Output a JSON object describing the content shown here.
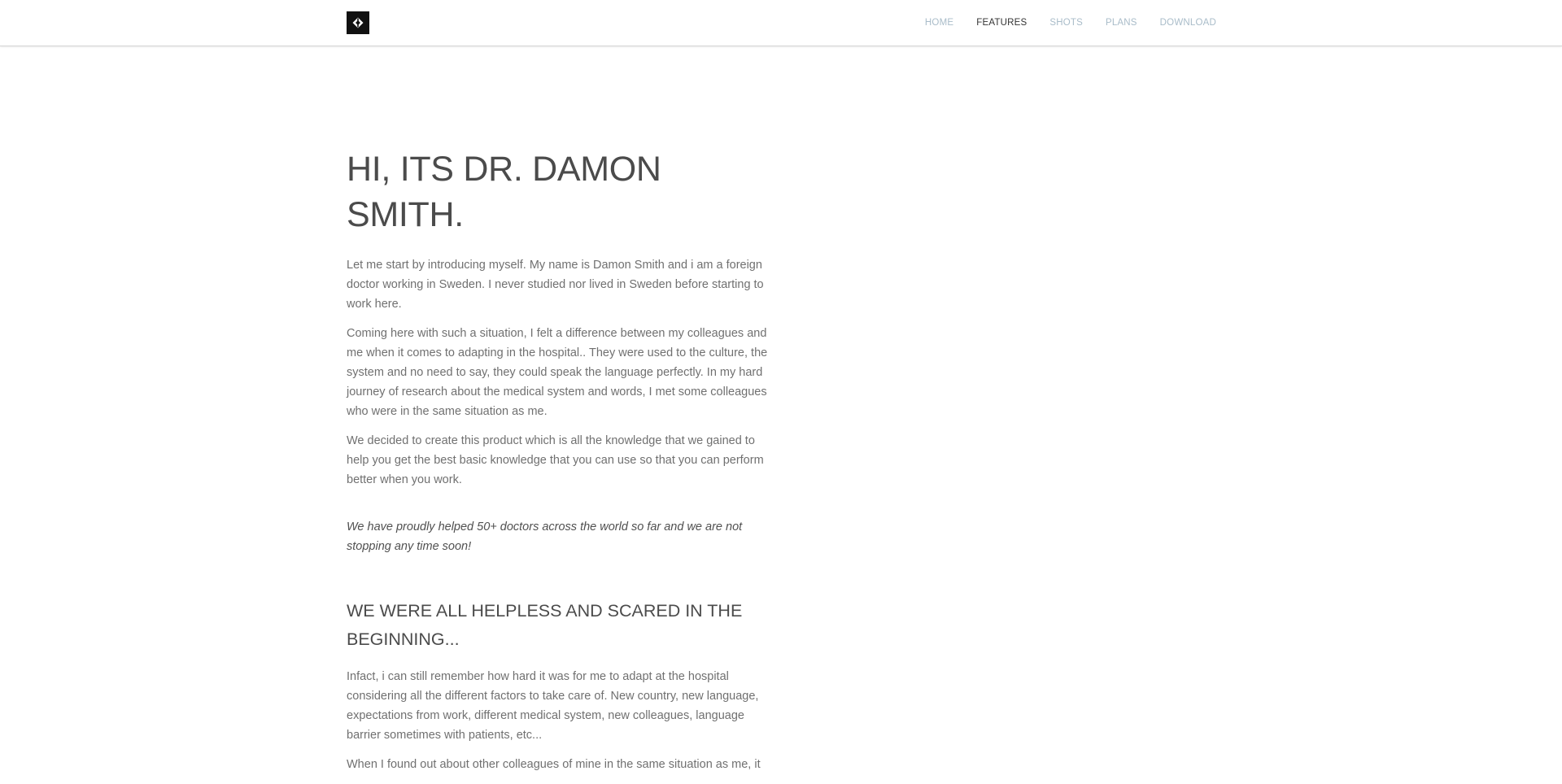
{
  "nav": {
    "logo_icon": "diamond-logo-icon",
    "items": [
      {
        "label": "HOME",
        "active": false
      },
      {
        "label": "FEATURES",
        "active": true
      },
      {
        "label": "SHOTS",
        "active": false
      },
      {
        "label": "PLANS",
        "active": false
      },
      {
        "label": "DOWNLOAD",
        "active": false
      }
    ]
  },
  "main": {
    "title": "HI, ITS DR. DAMON SMITH.",
    "paragraphs": [
      "Let me start by introducing myself. My name is Damon Smith and i am a foreign doctor working in Sweden. I never studied nor lived in Sweden before starting to work here.",
      "Coming here with such a situation, I felt a difference between my colleagues and me when it comes to adapting in the hospital.. They were used to the culture, the system and no need to say, they could speak the language perfectly. In my hard journey of research about the medical system and words, I met some colleagues who were in the same situation as me.",
      "We decided to create this product which is all the knowledge that we gained to help you get the best basic knowledge that you can use so that you can perform better when you work."
    ],
    "quote": "We have proudly helped 50+ doctors across the world so far and we are not stopping any time soon!",
    "subheading": "WE WERE ALL HELPLESS AND SCARED IN THE BEGINNING...",
    "paragraphs2": [
      "Infact, i can still remember how hard it was for me to adapt at the hospital considering all the different factors to take care of. New country, new language, expectations from work, different medical system, new colleagues, language barrier sometimes with patients, etc...",
      "When I found out about other colleagues of mine in the same situation as me, it"
    ]
  },
  "colors": {
    "nav_inactive": "#a9bcc9",
    "nav_active": "#333333",
    "heading": "#4b4b4b",
    "body_text": "#707070",
    "logo_bg": "#111111"
  }
}
